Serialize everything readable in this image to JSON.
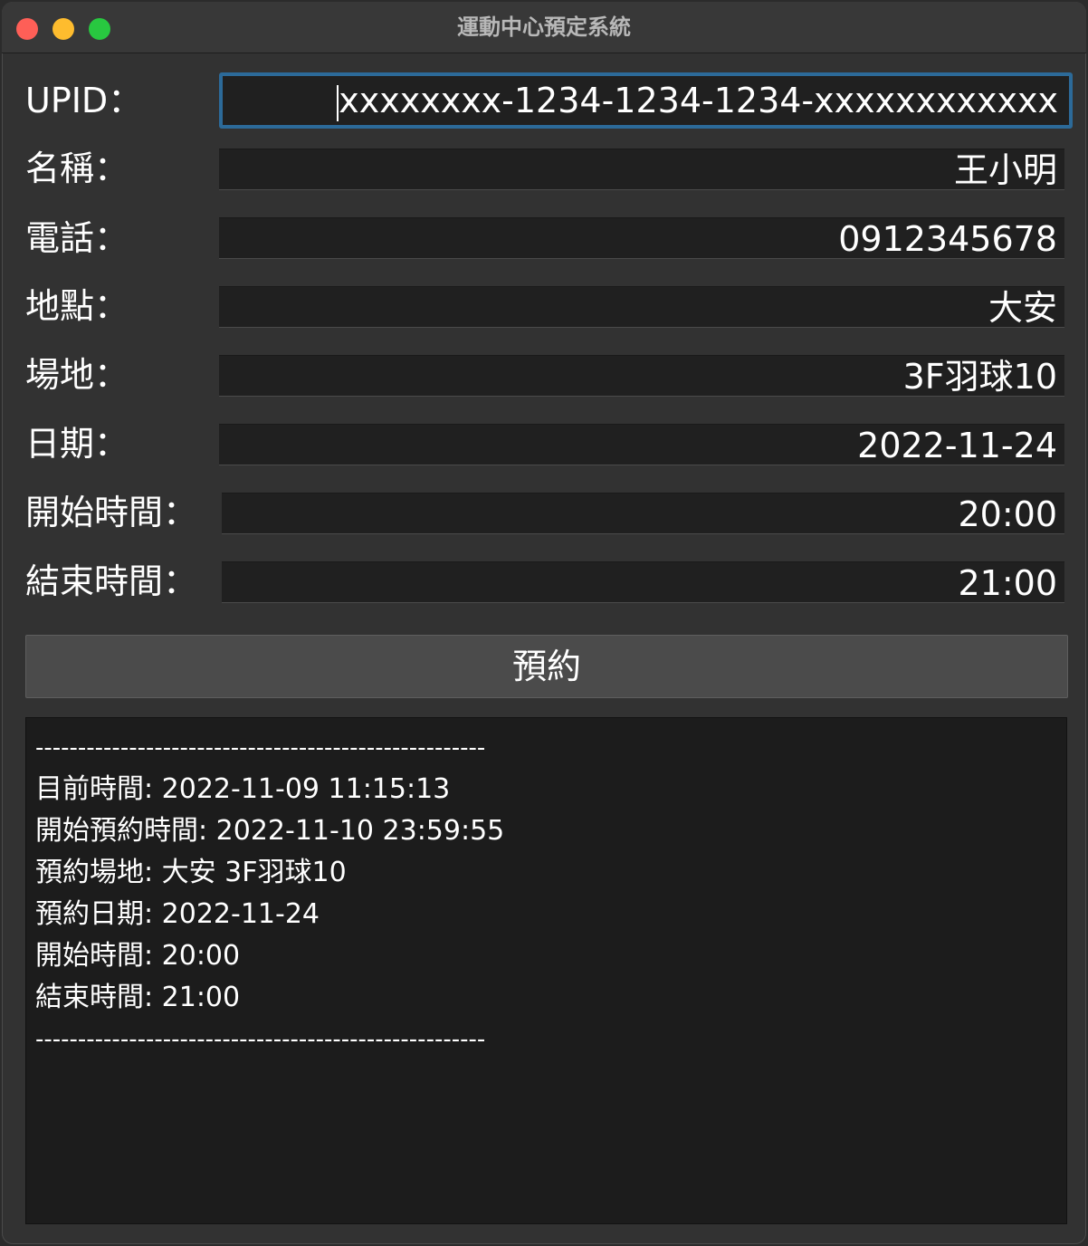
{
  "window": {
    "title": "運動中心預定系統"
  },
  "form": {
    "upid": {
      "label": "UPID：",
      "value": "xxxxxxxx-1234-1234-1234-xxxxxxxxxxxx"
    },
    "name": {
      "label": "名稱：",
      "value": "王小明"
    },
    "phone": {
      "label": "電話：",
      "value": "0912345678"
    },
    "location": {
      "label": "地點：",
      "value": "大安"
    },
    "court": {
      "label": "場地：",
      "value": "3F羽球10"
    },
    "date": {
      "label": "日期：",
      "value": "2022-11-24"
    },
    "start_time": {
      "label": "開始時間：",
      "value": "20:00"
    },
    "end_time": {
      "label": "結束時間：",
      "value": "21:00"
    }
  },
  "reserve_button": {
    "label": "預約"
  },
  "output": {
    "separator": "-----------------------------------------------------",
    "lines": [
      "目前時間: 2022-11-09 11:15:13",
      "開始預約時間: 2022-11-10 23:59:55",
      "預約場地: 大安 3F羽球10",
      "預約日期: 2022-11-24",
      "開始時間: 20:00",
      "結束時間: 21:00"
    ]
  }
}
